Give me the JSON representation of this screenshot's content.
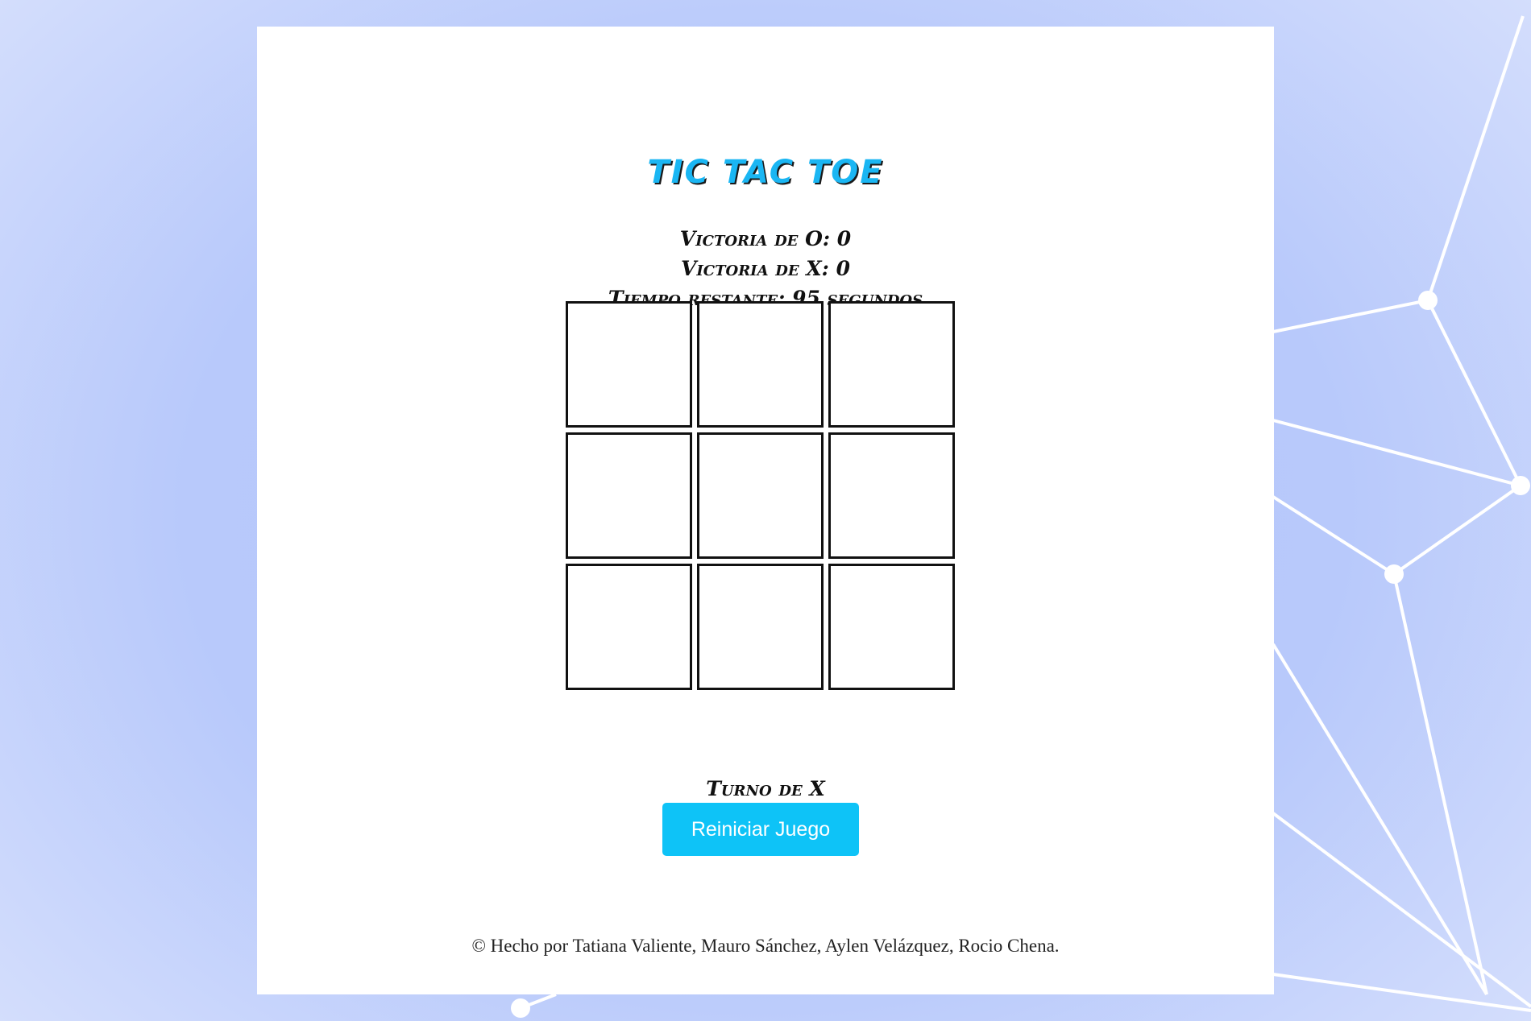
{
  "app": {
    "title": "TIC TAC TOE"
  },
  "scores": {
    "o_wins_text": "Victoria de O: 0",
    "x_wins_text": "Victoria de X: 0",
    "time_left_text": "Tiempo restante: 95 segundos"
  },
  "board": {
    "cells": [
      "",
      "",
      "",
      "",
      "",
      "",
      "",
      "",
      ""
    ]
  },
  "status": {
    "turn_text": "Turno de X"
  },
  "controls": {
    "reset_label": "Reiniciar Juego"
  },
  "footer": {
    "credits": "© Hecho por Tatiana Valiente, Mauro Sánchez, Aylen Velázquez, Rocio Chena."
  },
  "colors": {
    "accent": "#0ec3f7",
    "title": "#1ab6f3",
    "background": "#b3c6fb"
  }
}
